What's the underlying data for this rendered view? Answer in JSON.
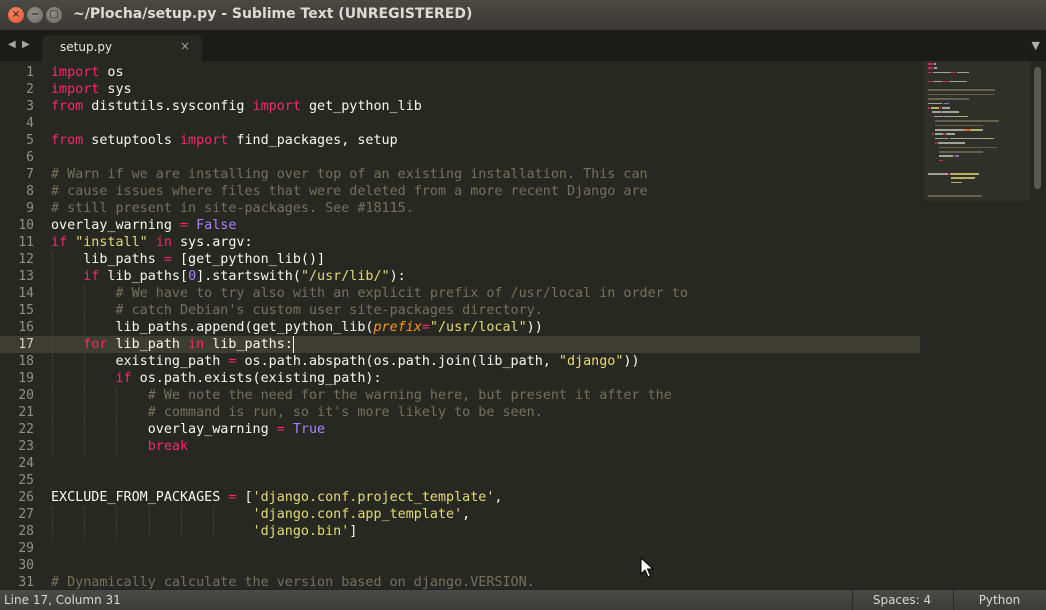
{
  "window": {
    "title": "~/Plocha/setup.py - Sublime Text (UNREGISTERED)",
    "close_glyph": "×",
    "minimize_glyph": "−",
    "maximize_glyph": "□"
  },
  "tabs": {
    "nav_left_glyph": "◀",
    "nav_right_glyph": "▶",
    "active_label": "setup.py",
    "close_glyph": "×",
    "dropdown_glyph": "▼"
  },
  "editor": {
    "current_line": 17,
    "lines": [
      {
        "n": "1",
        "tokens": [
          [
            "kw",
            "import"
          ],
          [
            "plain",
            " os"
          ]
        ]
      },
      {
        "n": "2",
        "tokens": [
          [
            "kw",
            "import"
          ],
          [
            "plain",
            " sys"
          ]
        ]
      },
      {
        "n": "3",
        "tokens": [
          [
            "kw",
            "from"
          ],
          [
            "plain",
            " distutils.sysconfig "
          ],
          [
            "kw",
            "import"
          ],
          [
            "plain",
            " get_python_lib"
          ]
        ]
      },
      {
        "n": "4",
        "tokens": []
      },
      {
        "n": "5",
        "tokens": [
          [
            "kw",
            "from"
          ],
          [
            "plain",
            " setuptools "
          ],
          [
            "kw",
            "import"
          ],
          [
            "plain",
            " find_packages, setup"
          ]
        ]
      },
      {
        "n": "6",
        "tokens": []
      },
      {
        "n": "7",
        "tokens": [
          [
            "com",
            "# Warn if we are installing over top of an existing installation. This can"
          ]
        ]
      },
      {
        "n": "8",
        "tokens": [
          [
            "com",
            "# cause issues where files that were deleted from a more recent Django are"
          ]
        ]
      },
      {
        "n": "9",
        "tokens": [
          [
            "com",
            "# still present in site-packages. See #18115."
          ]
        ]
      },
      {
        "n": "10",
        "tokens": [
          [
            "plain",
            "overlay_warning "
          ],
          [
            "kw",
            "="
          ],
          [
            "plain",
            " "
          ],
          [
            "const",
            "False"
          ]
        ]
      },
      {
        "n": "11",
        "tokens": [
          [
            "kw",
            "if"
          ],
          [
            "plain",
            " "
          ],
          [
            "str",
            "\"install\""
          ],
          [
            "plain",
            " "
          ],
          [
            "kw",
            "in"
          ],
          [
            "plain",
            " sys.argv:"
          ]
        ]
      },
      {
        "n": "12",
        "tokens": [
          [
            "plain",
            "    lib_paths "
          ],
          [
            "kw",
            "="
          ],
          [
            "plain",
            " [get_python_lib()]"
          ]
        ]
      },
      {
        "n": "13",
        "tokens": [
          [
            "plain",
            "    "
          ],
          [
            "kw",
            "if"
          ],
          [
            "plain",
            " lib_paths["
          ],
          [
            "num",
            "0"
          ],
          [
            "plain",
            "].startswith("
          ],
          [
            "str",
            "\"/usr/lib/\""
          ],
          [
            "plain",
            "):"
          ]
        ]
      },
      {
        "n": "14",
        "tokens": [
          [
            "plain",
            "        "
          ],
          [
            "com",
            "# We have to try also with an explicit prefix of /usr/local in order to"
          ]
        ]
      },
      {
        "n": "15",
        "tokens": [
          [
            "plain",
            "        "
          ],
          [
            "com",
            "# catch Debian's custom user site-packages directory."
          ]
        ]
      },
      {
        "n": "16",
        "tokens": [
          [
            "plain",
            "        lib_paths.append(get_python_lib("
          ],
          [
            "param",
            "prefix"
          ],
          [
            "kw",
            "="
          ],
          [
            "str",
            "\"/usr/local\""
          ],
          [
            "plain",
            "))"
          ]
        ]
      },
      {
        "n": "17",
        "tokens": [
          [
            "plain",
            "    "
          ],
          [
            "kw",
            "for"
          ],
          [
            "plain",
            " lib_path "
          ],
          [
            "kw",
            "in"
          ],
          [
            "plain",
            " lib_paths:"
          ]
        ]
      },
      {
        "n": "18",
        "tokens": [
          [
            "plain",
            "        existing_path "
          ],
          [
            "kw",
            "="
          ],
          [
            "plain",
            " os.path.abspath(os.path.join(lib_path, "
          ],
          [
            "str",
            "\"django\""
          ],
          [
            "plain",
            "))"
          ]
        ]
      },
      {
        "n": "19",
        "tokens": [
          [
            "plain",
            "        "
          ],
          [
            "kw",
            "if"
          ],
          [
            "plain",
            " os.path.exists(existing_path):"
          ]
        ]
      },
      {
        "n": "20",
        "tokens": [
          [
            "plain",
            "            "
          ],
          [
            "com",
            "# We note the need for the warning here, but present it after the"
          ]
        ]
      },
      {
        "n": "21",
        "tokens": [
          [
            "plain",
            "            "
          ],
          [
            "com",
            "# command is run, so it's more likely to be seen."
          ]
        ]
      },
      {
        "n": "22",
        "tokens": [
          [
            "plain",
            "            overlay_warning "
          ],
          [
            "kw",
            "="
          ],
          [
            "plain",
            " "
          ],
          [
            "const",
            "True"
          ]
        ]
      },
      {
        "n": "23",
        "tokens": [
          [
            "plain",
            "            "
          ],
          [
            "kw",
            "break"
          ]
        ]
      },
      {
        "n": "24",
        "tokens": []
      },
      {
        "n": "25",
        "tokens": []
      },
      {
        "n": "26",
        "tokens": [
          [
            "plain",
            "EXCLUDE_FROM_PACKAGES "
          ],
          [
            "kw",
            "="
          ],
          [
            "plain",
            " ["
          ],
          [
            "str",
            "'django.conf.project_template'"
          ],
          [
            "plain",
            ","
          ]
        ]
      },
      {
        "n": "27",
        "tokens": [
          [
            "plain",
            "                         "
          ],
          [
            "str",
            "'django.conf.app_template'"
          ],
          [
            "plain",
            ","
          ]
        ]
      },
      {
        "n": "28",
        "tokens": [
          [
            "plain",
            "                         "
          ],
          [
            "str",
            "'django.bin'"
          ],
          [
            "plain",
            "]"
          ]
        ]
      },
      {
        "n": "29",
        "tokens": []
      },
      {
        "n": "30",
        "tokens": []
      },
      {
        "n": "31",
        "tokens": [
          [
            "com",
            "# Dynamically calculate the version based on django.VERSION."
          ]
        ]
      }
    ]
  },
  "colors": {
    "background": "#272822",
    "keyword": "#f92672",
    "string": "#e6db74",
    "number": "#ae81ff",
    "comment": "#75715e",
    "parameter": "#fd971f",
    "text": "#f8f8f2"
  },
  "status": {
    "position": "Line 17, Column 31",
    "indentation": "Spaces: 4",
    "syntax": "Python"
  }
}
